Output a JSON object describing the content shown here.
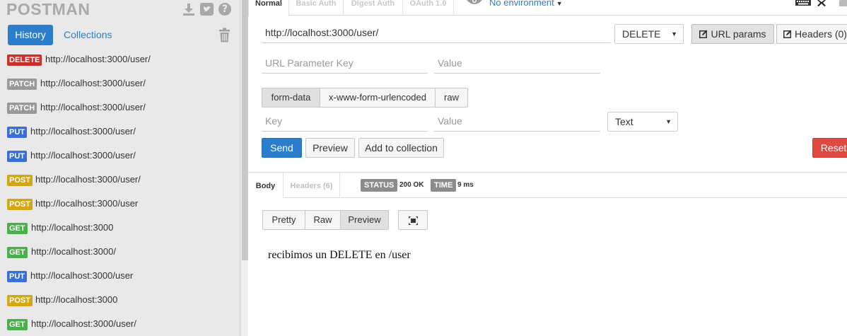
{
  "sidebar": {
    "logo": "POSTMAN",
    "icons": [
      "download-icon",
      "twitter-icon",
      "help-icon"
    ],
    "help_glyph": "?",
    "tabs": [
      {
        "label": "History",
        "active": true
      },
      {
        "label": "Collections",
        "active": false
      }
    ],
    "history": [
      {
        "method": "DELETE",
        "url": "http://localhost:3000/user/"
      },
      {
        "method": "PATCH",
        "url": "http://localhost:3000/user/"
      },
      {
        "method": "PATCH",
        "url": "http://localhost:3000/user/"
      },
      {
        "method": "PUT",
        "url": "http://localhost:3000/user/"
      },
      {
        "method": "PUT",
        "url": "http://localhost:3000/user/"
      },
      {
        "method": "POST",
        "url": "http://localhost:3000/user/"
      },
      {
        "method": "POST",
        "url": "http://localhost:3000/user"
      },
      {
        "method": "GET",
        "url": "http://localhost:3000"
      },
      {
        "method": "GET",
        "url": "http://localhost:3000/"
      },
      {
        "method": "PUT",
        "url": "http://localhost:3000/user"
      },
      {
        "method": "POST",
        "url": "http://localhost:3000"
      },
      {
        "method": "GET",
        "url": "http://localhost:3000/user/"
      }
    ]
  },
  "method_colors": {
    "DELETE": "#c9302c",
    "PATCH": "#999999",
    "PUT": "#3a6fd8",
    "POST": "#d4a514",
    "GET": "#4cae4c"
  },
  "auth_tabs": {
    "normal": "Normal",
    "basic": "Basic Auth",
    "digest": "Digest Auth",
    "oauth": "OAuth 1.0"
  },
  "environment": "No environment",
  "request": {
    "url": "http://localhost:3000/user/",
    "method": "DELETE",
    "url_params_label": "URL params",
    "headers_label": "Headers (0)",
    "param_key_placeholder": "URL Parameter Key",
    "param_value_placeholder": "Value",
    "body_modes": [
      "form-data",
      "x-www-form-urlencoded",
      "raw"
    ],
    "body_key_placeholder": "Key",
    "body_value_placeholder": "Value",
    "body_type": "Text",
    "send_label": "Send",
    "preview_label": "Preview",
    "add_collection_label": "Add to collection",
    "reset_label": "Reset"
  },
  "response": {
    "body_tab": "Body",
    "headers_tab": "Headers (6)",
    "status_label": "STATUS",
    "status_value": "200 OK",
    "time_label": "TIME",
    "time_value": "9 ms",
    "view_modes": [
      "Pretty",
      "Raw",
      "Preview"
    ],
    "active_view": "Preview",
    "body_text": "recibimos un DELETE en /user"
  }
}
